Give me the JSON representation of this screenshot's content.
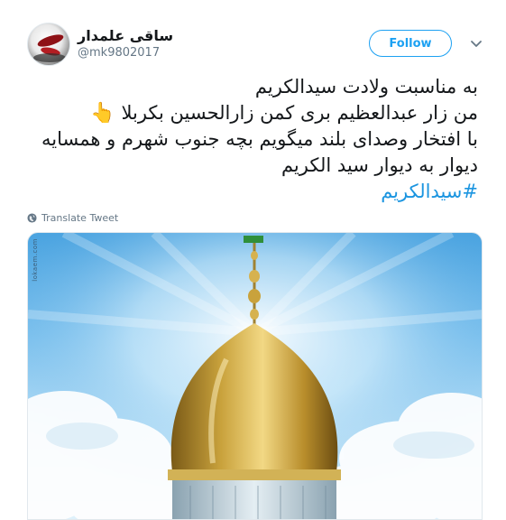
{
  "tweet": {
    "author": {
      "display_name": "ساقی علمدار",
      "handle": "@mk9802017"
    },
    "follow_label": "Follow",
    "text_lines": [
      "به مناسبت ولادت سیدالکریم",
      "من زار عبدالعظیم بری کمن زارالحسین بکربلا",
      "با افتخار وصدای بلند میگویم بچه جنوب شهرم و همسایه",
      "دیوار به دیوار سید الکریم"
    ],
    "pointing_emoji": "👆",
    "hashtag": "#سیدالکریم",
    "translate_label": "Translate Tweet",
    "media": {
      "description_icon": "shrine-dome-image",
      "watermark": "lokaem.com"
    }
  },
  "colors": {
    "accent": "#1da1f2",
    "hashtag": "#1b95e0",
    "secondary_text": "#657786",
    "dome_gold": "#c9a23c"
  }
}
